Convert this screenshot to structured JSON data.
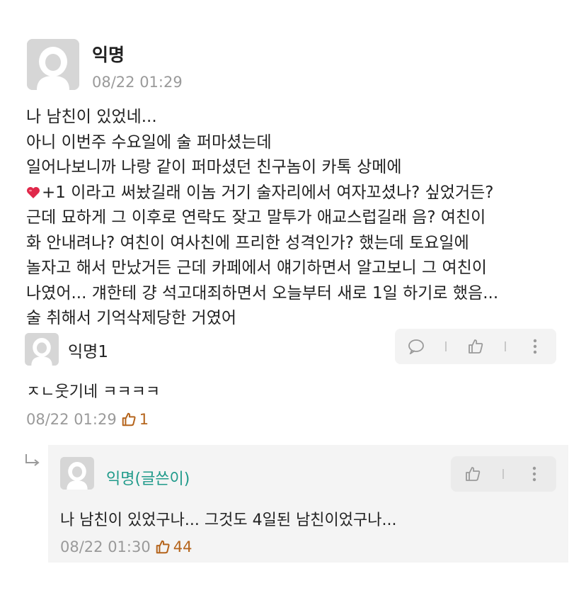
{
  "post": {
    "author": "익명",
    "timestamp": "08/22 01:29",
    "lines": [
      "나 남친이 있었네...",
      "아니 이번주 수요일에 술 퍼마셨는데",
      "일어나보니까 나랑 같이 퍼마셨던 친구놈이 카톡 상메에",
      "+1 이라고 써놨길래 이놈 거기 술자리에서 여자꼬셨나? 싶었거든?",
      "근데 묘하게 그 이후로 연락도 잦고 말투가 애교스럽길래 음? 여친이",
      "화 안내려나? 여친이 여사친에 프리한 성격인가? 했는데 토요일에",
      "놀자고 해서 만났거든 근데 카페에서 얘기하면서 알고보니 그 여친이",
      "나였어... 걔한테 걍 석고대죄하면서 오늘부터 새로 1일 하기로 했음...",
      "술 취해서 기억삭제당한 거였어"
    ]
  },
  "comments": [
    {
      "author": "익명1",
      "text": "ㅈㄴ웃기네 ㅋㅋㅋㅋ",
      "timestamp": "08/22 01:29",
      "likes": "1"
    }
  ],
  "reply": {
    "author": "익명(글쓴이)",
    "text": "나 남친이 있었구나... 그것도 4일된 남친이었구나...",
    "timestamp": "08/22 01:30",
    "likes": "44"
  },
  "icons": {
    "avatar": "person-avatar-icon",
    "heart": "red-heart-icon",
    "comment": "speech-bubble-icon",
    "like": "thumbs-up-icon",
    "more": "vertical-ellipsis-icon",
    "reply": "reply-arrow-icon"
  },
  "colors": {
    "op_author": "#1f9a8a",
    "likes": "#b5651d",
    "heart": "#e0284a",
    "meta": "#9a9a9a"
  }
}
